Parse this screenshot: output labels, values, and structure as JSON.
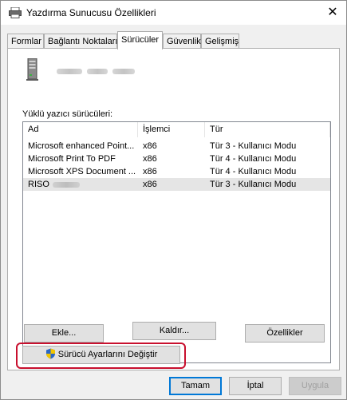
{
  "window": {
    "title": "Yazdırma Sunucusu Özellikleri",
    "close_glyph": "✕"
  },
  "tabs": [
    {
      "label": "Formlar"
    },
    {
      "label": "Bağlantı Noktaları"
    },
    {
      "label": "Sürücüler",
      "active": true
    },
    {
      "label": "Güvenlik"
    },
    {
      "label": "Gelişmiş"
    }
  ],
  "drivers": {
    "section_label": "Yüklü yazıcı sürücüleri:",
    "columns": [
      "Ad",
      "İşlemci",
      "Tür"
    ],
    "rows": [
      {
        "name": "Microsoft enhanced Point...",
        "processor": "x86",
        "type": "Tür 3 - Kullanıcı Modu"
      },
      {
        "name": "Microsoft Print To PDF",
        "processor": "x86",
        "type": "Tür 4 - Kullanıcı Modu"
      },
      {
        "name": "Microsoft XPS Document ...",
        "processor": "x86",
        "type": "Tür 4 - Kullanıcı Modu"
      },
      {
        "name": "RISO",
        "processor": "x86",
        "type": "Tür 3 - Kullanıcı Modu",
        "selected": true
      }
    ]
  },
  "buttons": {
    "add": "Ekle...",
    "remove": "Kaldır...",
    "properties": "Özellikler",
    "change_settings": "Sürücü Ayarlarını Değiştir",
    "ok": "Tamam",
    "cancel": "İptal",
    "apply": "Uygula"
  },
  "colors": {
    "highlight": "#c8102e",
    "default_button_border": "#0078d7",
    "selection": "#e5e5e5"
  }
}
